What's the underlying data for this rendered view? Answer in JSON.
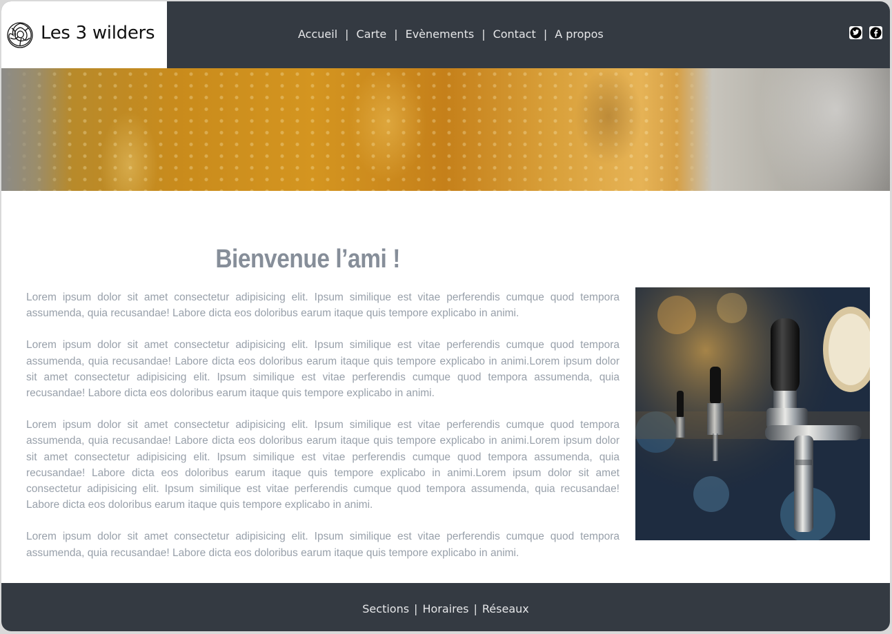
{
  "brand": {
    "name": "Les 3 wilders",
    "logo_icon": "flower-outline-icon"
  },
  "nav": {
    "items": [
      {
        "label": "Accueil"
      },
      {
        "label": "Carte"
      },
      {
        "label": "Evènements"
      },
      {
        "label": "Contact"
      },
      {
        "label": "A propos"
      }
    ],
    "separator": "|"
  },
  "social": [
    {
      "icon": "twitter-icon"
    },
    {
      "icon": "facebook-icon"
    }
  ],
  "banner": {
    "alt": "beer-glass-banner"
  },
  "main": {
    "title": "Bienvenue l’ami !",
    "paragraphs": [
      "Lorem ipsum dolor sit amet consectetur adipisicing elit. Ipsum similique est vitae perferendis cumque quod tempora assumenda, quia recusandae! Labore dicta eos doloribus earum itaque quis tempore explicabo in animi.",
      "Lorem ipsum dolor sit amet consectetur adipisicing elit. Ipsum similique est vitae perferendis cumque quod tempora assumenda, quia recusandae! Labore dicta eos doloribus earum itaque quis tempore explicabo in animi.Lorem ipsum dolor sit amet consectetur adipisicing elit. Ipsum similique est vitae perferendis cumque quod tempora assumenda, quia recusandae! Labore dicta eos doloribus earum itaque quis tempore explicabo in animi.",
      "Lorem ipsum dolor sit amet consectetur adipisicing elit. Ipsum similique est vitae perferendis cumque quod tempora assumenda, quia recusandae! Labore dicta eos doloribus earum itaque quis tempore explicabo in animi.Lorem ipsum dolor sit amet consectetur adipisicing elit. Ipsum similique est vitae perferendis cumque quod tempora assumenda, quia recusandae! Labore dicta eos doloribus earum itaque quis tempore explicabo in animi.Lorem ipsum dolor sit amet consectetur adipisicing elit. Ipsum similique est vitae perferendis cumque quod tempora assumenda, quia recusandae! Labore dicta eos doloribus earum itaque quis tempore explicabo in animi.",
      "Lorem ipsum dolor sit amet consectetur adipisicing elit. Ipsum similique est vitae perferendis cumque quod tempora assumenda, quia recusandae! Labore dicta eos doloribus earum itaque quis tempore explicabo in animi."
    ],
    "photo": {
      "alt": "beer-taps-photo"
    }
  },
  "footer": {
    "items": [
      {
        "label": "Sections"
      },
      {
        "label": "Horaires"
      },
      {
        "label": "Réseaux"
      }
    ]
  },
  "colors": {
    "header_bg": "#343a42",
    "nav_text": "#e6e7e9",
    "title_text": "#868e99",
    "body_text": "#98a0aa"
  }
}
